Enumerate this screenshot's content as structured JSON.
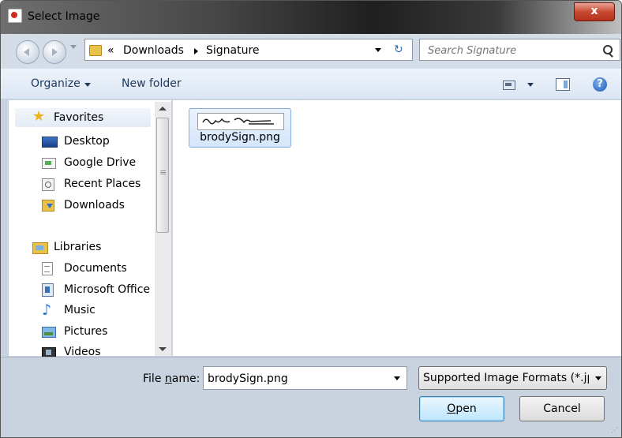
{
  "window": {
    "title": "Select Image",
    "close_label": "x"
  },
  "nav": {
    "breadcrumb_prefix": "«",
    "breadcrumbs": [
      "Downloads",
      "Signature"
    ],
    "search_placeholder": "Search Signature"
  },
  "toolbar": {
    "organize_label": "Organize",
    "new_folder_label": "New folder",
    "help_label": "?"
  },
  "sidebar": {
    "favorites": {
      "label": "Favorites",
      "items": [
        "Desktop",
        "Google Drive",
        "Recent Places",
        "Downloads"
      ]
    },
    "libraries": {
      "label": "Libraries",
      "items": [
        "Documents",
        "Microsoft Office",
        "Music",
        "Pictures",
        "Videos"
      ]
    }
  },
  "files": [
    {
      "name": "brodySign.png"
    }
  ],
  "bottom": {
    "filename_label_prefix": "File ",
    "filename_label_accel": "n",
    "filename_label_suffix": "ame:",
    "filename_value": "brodySign.png",
    "filter_value": "Supported Image Formats (*.jpɡ",
    "open_accel": "O",
    "open_rest": "pen",
    "cancel_label": "Cancel"
  }
}
